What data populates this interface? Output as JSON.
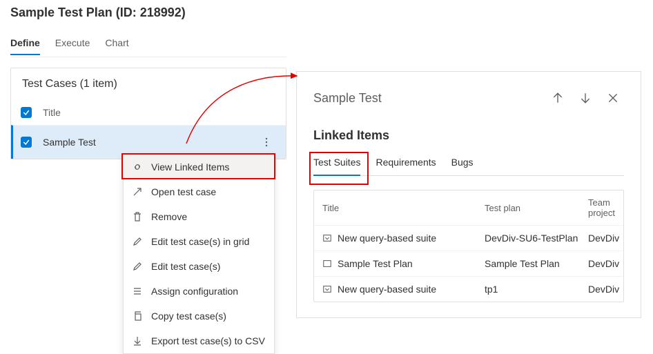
{
  "page": {
    "title": "Sample Test Plan (ID: 218992)"
  },
  "tabs": {
    "define": "Define",
    "execute": "Execute",
    "chart": "Chart"
  },
  "list": {
    "header": "Test Cases (1 item)",
    "colTitle": "Title",
    "items": [
      {
        "title": "Sample Test"
      }
    ]
  },
  "menu": {
    "viewLinked": "View Linked Items",
    "open": "Open test case",
    "remove": "Remove",
    "editGrid": "Edit test case(s) in grid",
    "edit": "Edit test case(s)",
    "assign": "Assign configuration",
    "copy": "Copy test case(s)",
    "export": "Export test case(s) to CSV"
  },
  "panel": {
    "title": "Sample Test",
    "sub": "Linked Items",
    "tabs": {
      "suites": "Test Suites",
      "req": "Requirements",
      "bugs": "Bugs"
    },
    "columns": {
      "c1": "Title",
      "c2": "Test plan",
      "c3": "Team project"
    },
    "rows": [
      {
        "icon": "qsuite",
        "title": "New query-based suite",
        "plan": "DevDiv-SU6-TestPlan",
        "proj": "DevDiv"
      },
      {
        "icon": "plan",
        "title": "Sample Test Plan",
        "plan": "Sample Test Plan",
        "proj": "DevDiv"
      },
      {
        "icon": "qsuite",
        "title": "New query-based suite",
        "plan": "tp1",
        "proj": "DevDiv"
      }
    ]
  }
}
